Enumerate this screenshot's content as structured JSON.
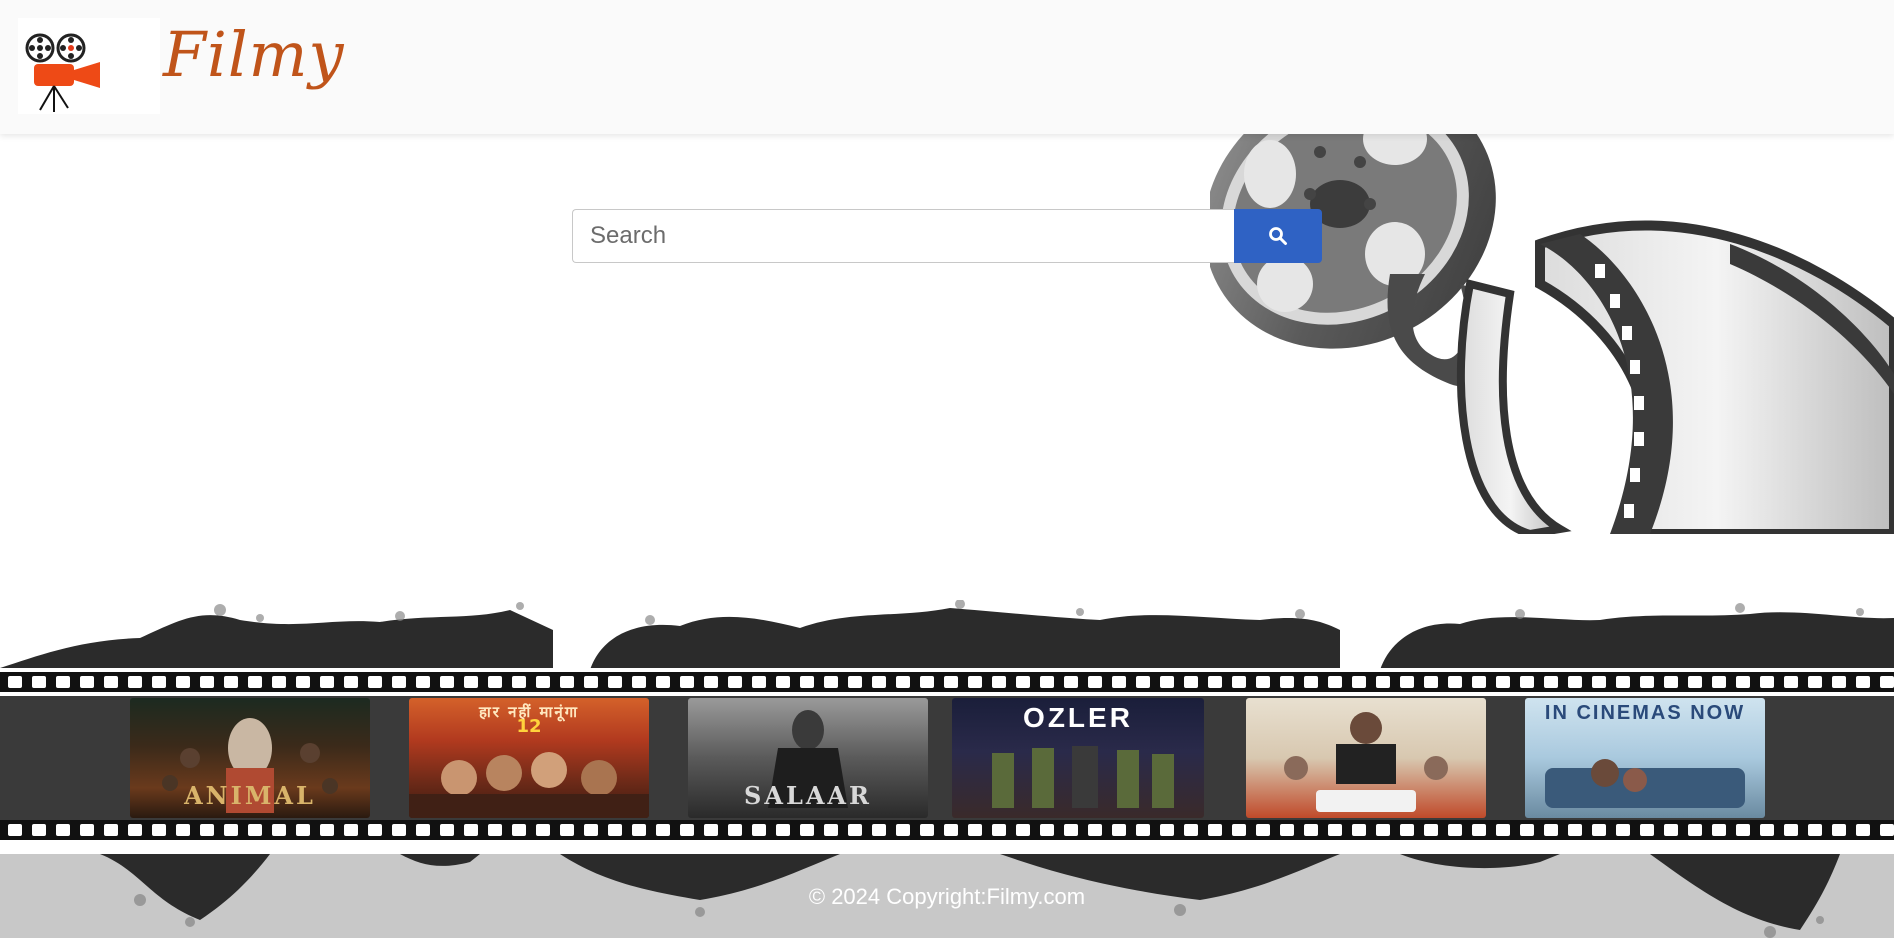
{
  "header": {
    "brand": "Filmy",
    "logo_icon": "movie-projector-icon"
  },
  "search": {
    "placeholder": "Search",
    "value": "",
    "button_icon": "search-icon"
  },
  "posters": [
    {
      "title": "ANIMAL",
      "top_text": ""
    },
    {
      "title": "",
      "top_text": "हार नहीं मानूंगा"
    },
    {
      "title": "SALAAR",
      "top_text": ""
    },
    {
      "title": "",
      "top_text": "OZLER"
    },
    {
      "title": "",
      "top_text": ""
    },
    {
      "title": "",
      "top_text": "IN CINEMAS NOW"
    }
  ],
  "footer": {
    "copyright": "© 2024 Copyright:Filmy.com"
  },
  "colors": {
    "brand": "#c0541a",
    "search_button": "#2f62c4",
    "footer_bg": "#c8c8c8",
    "header_bg": "#fafafa"
  }
}
